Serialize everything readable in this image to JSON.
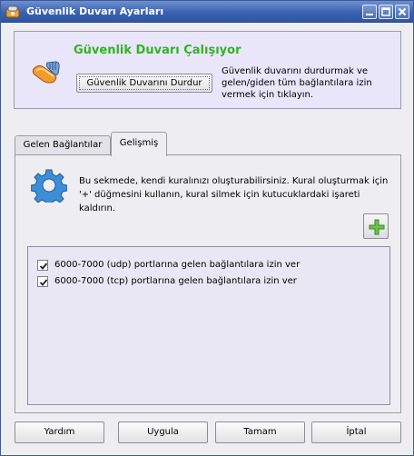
{
  "window": {
    "title": "Güvenlik Duvarı Ayarları",
    "icon": "firewall-app-icon"
  },
  "status": {
    "title": "Güvenlik Duvarı Çalışıyor",
    "title_color": "#33b325",
    "stop_button_label": "Güvenlik Duvarını Durdur",
    "description": "Güvenlik duvarını durdurmak ve gelen/giden tüm bağlantılara izin vermek için tıklayın."
  },
  "tabs": [
    {
      "label": "Gelen Bağlantılar",
      "selected": false
    },
    {
      "label": "Gelişmiş",
      "selected": true
    }
  ],
  "advanced": {
    "info": "Bu sekmede, kendi kuralınızı oluşturabilirsiniz. Kural oluşturmak için '+' düğmesini kullanın, kural silmek için kutucuklardaki işareti kaldırın.",
    "add_button_icon": "plus-icon",
    "rules": [
      {
        "label": "6000-7000 (udp) portlarına gelen bağlantılara izin ver",
        "checked": true
      },
      {
        "label": "6000-7000 (tcp) portlarına gelen bağlantılara izin ver",
        "checked": true
      }
    ]
  },
  "buttons": {
    "help": "Yardım",
    "apply": "Uygula",
    "ok": "Tamam",
    "cancel": "İptal"
  }
}
